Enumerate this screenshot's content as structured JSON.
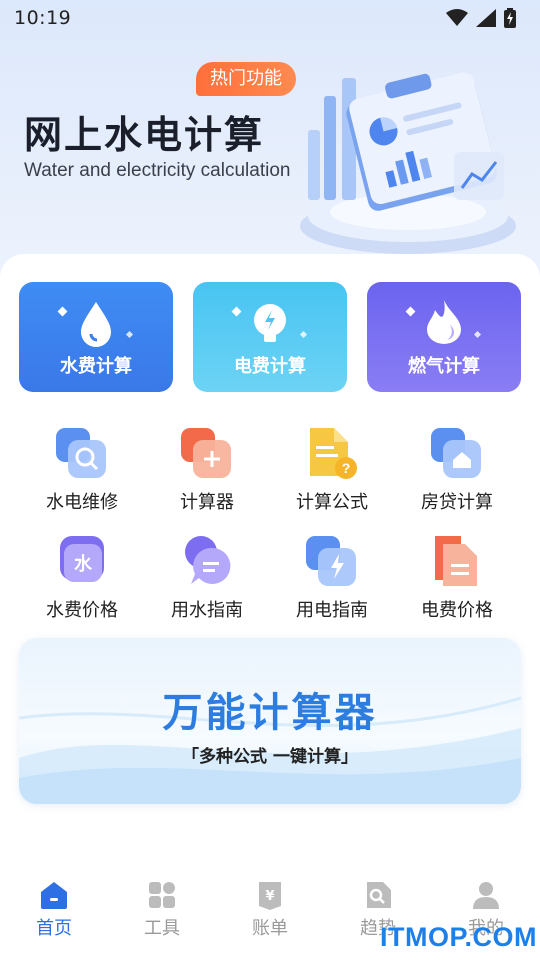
{
  "status_bar": {
    "time": "10:19",
    "icons": [
      "wifi-icon",
      "signal-icon",
      "battery-charging-icon"
    ]
  },
  "hero": {
    "badge": "热门功能",
    "title": "网上水电计算",
    "subtitle": "Water and electricity calculation"
  },
  "quick_actions": [
    {
      "label": "水费计算",
      "icon": "water-drop-icon",
      "color": "#3a7ff0"
    },
    {
      "label": "电费计算",
      "icon": "lightbulb-icon",
      "color": "#4cc6f3"
    },
    {
      "label": "燃气计算",
      "icon": "flame-icon",
      "color": "#7469f1"
    }
  ],
  "tools": [
    {
      "label": "水电维修",
      "icon": "search-repair-icon"
    },
    {
      "label": "计算器",
      "icon": "calculator-icon"
    },
    {
      "label": "计算公式",
      "icon": "formula-document-icon"
    },
    {
      "label": "房贷计算",
      "icon": "house-icon"
    },
    {
      "label": "水费价格",
      "icon": "water-price-icon"
    },
    {
      "label": "用水指南",
      "icon": "chat-guide-icon"
    },
    {
      "label": "用电指南",
      "icon": "lightning-guide-icon"
    },
    {
      "label": "电费价格",
      "icon": "price-document-icon"
    }
  ],
  "banner": {
    "title": "万能计算器",
    "subtitle": "「多种公式 一键计算」"
  },
  "tabbar": [
    {
      "label": "首页",
      "icon": "home-icon",
      "active": true
    },
    {
      "label": "工具",
      "icon": "grid-tools-icon",
      "active": false
    },
    {
      "label": "账单",
      "icon": "bill-icon",
      "active": false
    },
    {
      "label": "趋势",
      "icon": "trend-icon",
      "active": false
    },
    {
      "label": "我的",
      "icon": "profile-icon",
      "active": false
    }
  ],
  "watermark": "ITMOP.COM",
  "colors": {
    "accent": "#2f6fe4",
    "badge": "#ff7440",
    "banner_title": "#2d7de0"
  }
}
